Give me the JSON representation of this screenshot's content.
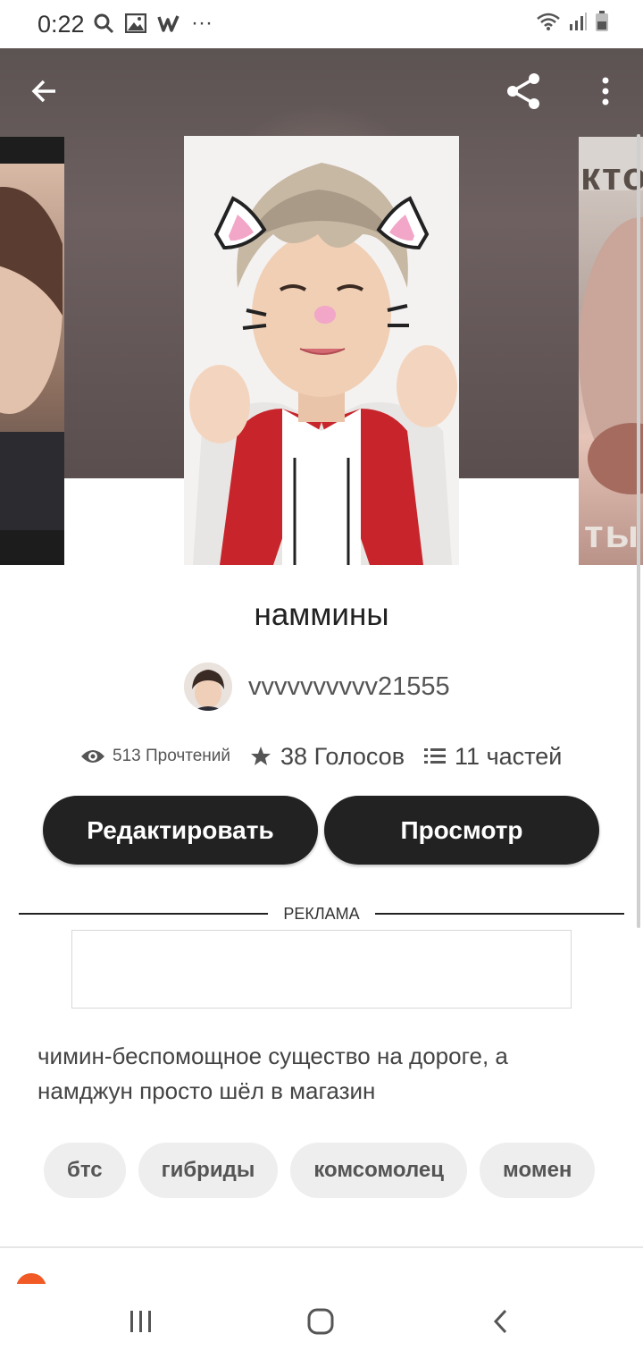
{
  "status_bar": {
    "time": "0:22",
    "left_icons": [
      "search-icon",
      "image-icon",
      "wattpad-icon",
      "more-notifications-icon"
    ],
    "right_icons": [
      "wifi-icon",
      "signal-icon",
      "battery-icon"
    ]
  },
  "toolbar": {
    "icons": [
      "back-arrow-icon",
      "share-icon",
      "overflow-menu-icon"
    ]
  },
  "covers": {
    "right_partial_text_top": "кто",
    "right_partial_text_bottom": "ты н"
  },
  "story": {
    "title": "наммины",
    "author": "vvvvvvvvvv21555",
    "reads": "513 Прочтений",
    "votes": "38 Голосов",
    "parts": "11 частей"
  },
  "buttons": {
    "edit": "Редактировать",
    "preview": "Просмотр"
  },
  "ad": {
    "label": "РЕКЛАМА"
  },
  "description": "чимин-беспомощное существо на дороге, а намджун просто шёл в магазин",
  "tags": [
    "бтс",
    "гибриды",
    "комсомолец",
    "момен"
  ],
  "colors": {
    "button_bg": "#222222",
    "tag_bg": "#eeeeee",
    "accent_orange": "#f15a24"
  }
}
